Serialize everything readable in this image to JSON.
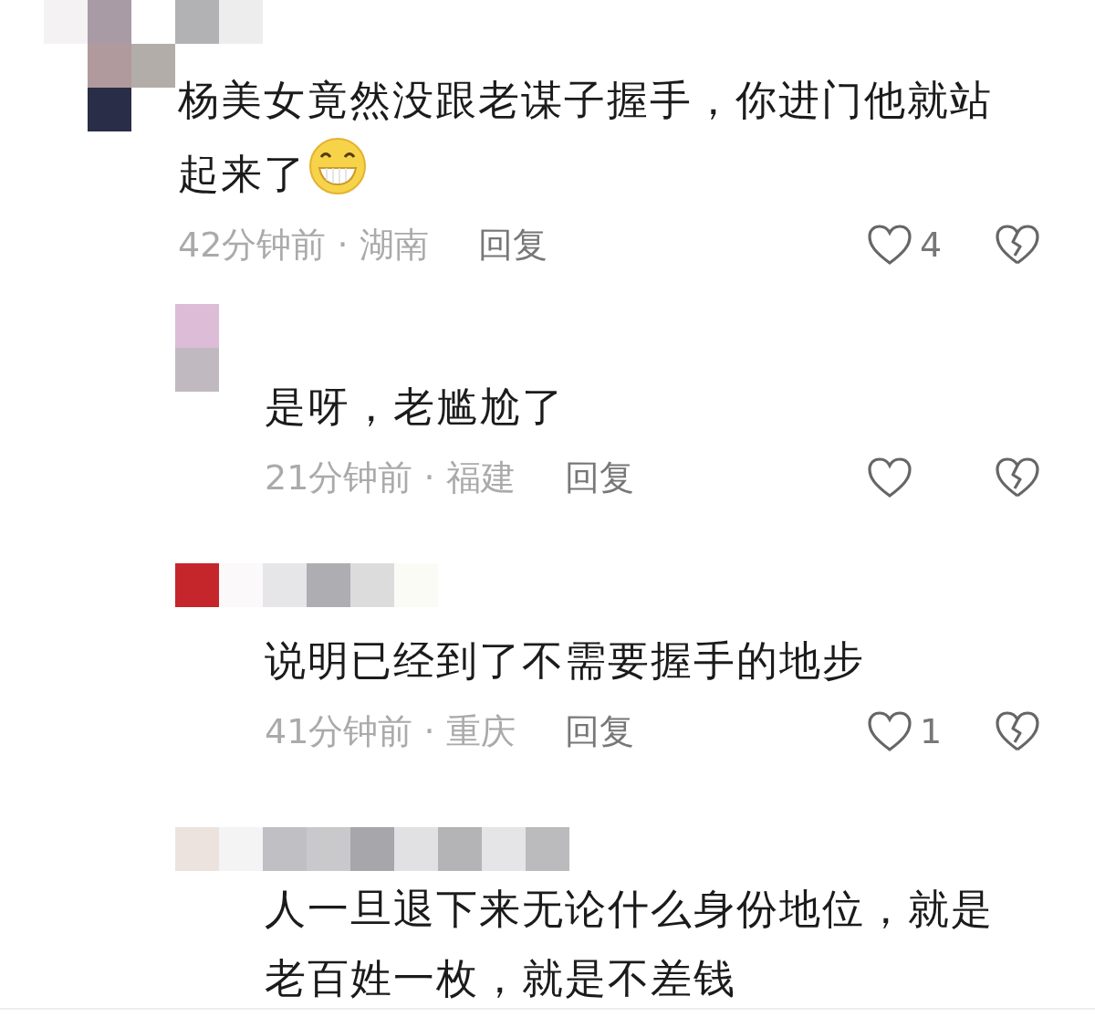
{
  "comments": [
    {
      "kind": "top",
      "lines": [
        "杨美女竟然没跟老谋子握手，你进门他就站",
        "起来了"
      ],
      "emoji": true,
      "meta": "42分钟前 · 湖南",
      "reply_label": "回复",
      "likes": "4"
    },
    {
      "kind": "reply",
      "lines": [
        "是呀，老尴尬了"
      ],
      "emoji": false,
      "meta": "21分钟前 · 福建",
      "reply_label": "回复"
    },
    {
      "kind": "reply",
      "lines": [
        "说明已经到了不需要握手的地步"
      ],
      "emoji": false,
      "meta": "41分钟前 · 重庆",
      "reply_label": "回复",
      "likes": "1"
    },
    {
      "kind": "reply",
      "lines": [
        "人一旦退下来无论什么身份地位，就是",
        "老百姓一枚，就是不差钱"
      ],
      "emoji": false
    }
  ]
}
